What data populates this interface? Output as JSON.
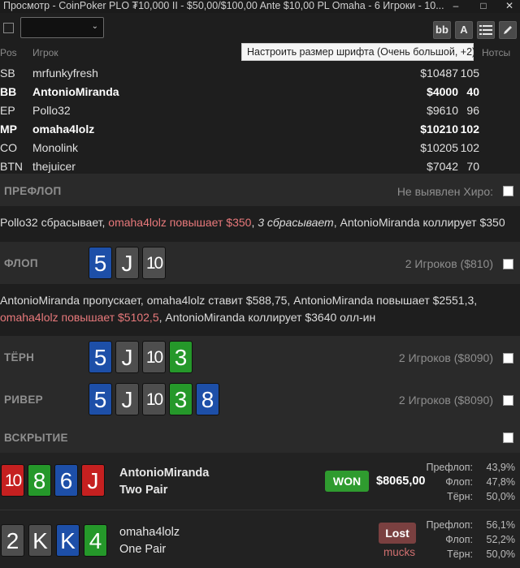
{
  "window": {
    "title": "Просмотр - CoinPoker PLO ₮10,000 II - $50,00/$100,00 Ante $10,00 PL Omaha - 6 Игроки - 10...",
    "minimize": "–",
    "maximize": "□",
    "close": "✕"
  },
  "toolbar": {
    "bb_label": "bb",
    "font_label": "A",
    "tooltip": "Настроить размер шрифта (Очень большой, +2)"
  },
  "table_headers": {
    "pos": "Pos",
    "player": "Игрок",
    "hands": "Нотсы"
  },
  "players": [
    {
      "pos": "SB",
      "name": "mrfunkyfresh",
      "stack": "$10487",
      "bb": "105",
      "bold": false
    },
    {
      "pos": "BB",
      "name": "AntonioMiranda",
      "stack": "$4000",
      "bb": "40",
      "bold": true
    },
    {
      "pos": "EP",
      "name": "Pollo32",
      "stack": "$9610",
      "bb": "96",
      "bold": false
    },
    {
      "pos": "MP",
      "name": "omaha4lolz",
      "stack": "$10210",
      "bb": "102",
      "bold": true
    },
    {
      "pos": "CO",
      "name": "Monolink",
      "stack": "$10205",
      "bb": "102",
      "bold": false
    },
    {
      "pos": "BTN",
      "name": "thejuicer",
      "stack": "$7042",
      "bb": "70",
      "bold": false
    }
  ],
  "preflop": {
    "label": "ПРЕФЛОП",
    "hero_text": "Не выявлен Хиро:",
    "actions": {
      "a1": "Pollo32 сбрасывает, ",
      "a2": "omaha4lolz повышает $350",
      "a3": ", ",
      "a4": "3 сбрасывает",
      "a5": ", AntonioMiranda коллирует $350"
    }
  },
  "flop": {
    "label": "ФЛОП",
    "players_text": "2 Игроков ($810)",
    "cards": [
      {
        "rank": "5",
        "color": "#1d4fa8"
      },
      {
        "rank": "J",
        "color": "#4e4e4e"
      },
      {
        "rank": "10",
        "color": "#4e4e4e"
      }
    ],
    "actions": {
      "line1": "AntonioMiranda пропускает, omaha4lolz ставит $588,75, AntonioMiranda повышает $2551,3,",
      "line2_red": "omaha4lolz повышает $5102,5",
      "line2_rest": ", AntonioMiranda коллирует $3640 олл-ин"
    }
  },
  "turn": {
    "label": "ТЁРН",
    "players_text": "2 Игроков ($8090)",
    "cards": [
      {
        "rank": "5",
        "color": "#1d4fa8"
      },
      {
        "rank": "J",
        "color": "#4e4e4e"
      },
      {
        "rank": "10",
        "color": "#4e4e4e"
      },
      {
        "rank": "3",
        "color": "#25982a"
      }
    ]
  },
  "river": {
    "label": "РИВЕР",
    "players_text": "2 Игроков ($8090)",
    "cards": [
      {
        "rank": "5",
        "color": "#1d4fa8"
      },
      {
        "rank": "J",
        "color": "#4e4e4e"
      },
      {
        "rank": "10",
        "color": "#4e4e4e"
      },
      {
        "rank": "3",
        "color": "#25982a"
      },
      {
        "rank": "8",
        "color": "#1d4fa8"
      }
    ]
  },
  "showdown": {
    "label": "ВСКРЫТИЕ",
    "p1": {
      "name": "AntonioMiranda",
      "hand": "Two Pair",
      "result": "WON",
      "amount": "$8065,00",
      "cards": [
        {
          "rank": "10",
          "color": "#c52020"
        },
        {
          "rank": "8",
          "color": "#25982a"
        },
        {
          "rank": "6",
          "color": "#1d4fa8"
        },
        {
          "rank": "J",
          "color": "#c52020"
        }
      ],
      "equity": [
        {
          "k": "Префлоп:",
          "v": "43,9%"
        },
        {
          "k": "Флоп:",
          "v": "47,8%"
        },
        {
          "k": "Тёрн:",
          "v": "50,0%"
        }
      ]
    },
    "p2": {
      "name": "omaha4lolz",
      "hand": "One Pair",
      "result": "Lost",
      "mucks": "mucks",
      "cards": [
        {
          "rank": "2",
          "color": "#4e4e4e"
        },
        {
          "rank": "K",
          "color": "#4e4e4e"
        },
        {
          "rank": "K",
          "color": "#1d4fa8"
        },
        {
          "rank": "4",
          "color": "#25982a"
        }
      ],
      "equity": [
        {
          "k": "Префлоп:",
          "v": "56,1%"
        },
        {
          "k": "Флоп:",
          "v": "52,2%"
        },
        {
          "k": "Тёрн:",
          "v": "50,0%"
        }
      ]
    }
  }
}
